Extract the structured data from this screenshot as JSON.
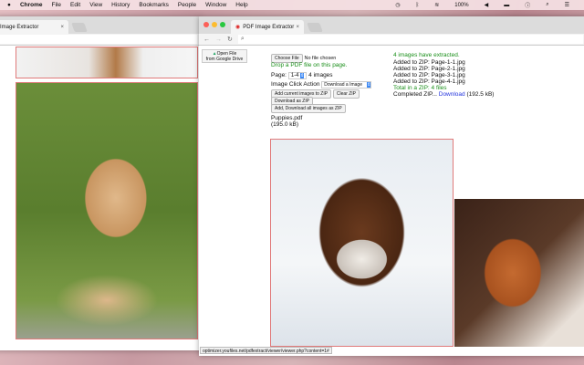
{
  "menubar": {
    "apple": "",
    "app": "Chrome",
    "items": [
      "File",
      "Edit",
      "View",
      "History",
      "Bookmarks",
      "People",
      "Window",
      "Help"
    ],
    "battery": "100%"
  },
  "back_window": {
    "tab_title": "Image Extractor"
  },
  "front_window": {
    "tab_title": "PDF Image Extractor",
    "status_url": "optimizer.youfiles.net/pdfextract/viewer/viewer.php?content=1#"
  },
  "page": {
    "drive_button": [
      "Open File",
      "from Google Drive"
    ],
    "choose_file": "Choose File",
    "no_file": "No file chosen",
    "drop_hint": "Drop a PDF file on this page.",
    "page_label": "Page:",
    "page_value": "1-4",
    "image_count": "4 images",
    "click_action_label": "Image Click Action",
    "click_action_value": "Download a Image",
    "add_zip": "Add current images to ZIP",
    "clear_zip": "Clear ZIP",
    "download_zip": "Download as ZIP",
    "add_download_all": "Add, Download all images as ZIP",
    "file_name": "Puppies.pdf",
    "file_size": "(195.0 kB)"
  },
  "log": {
    "extracted": "4 images have extracted.",
    "added": [
      "Added to ZIP: Page-1-1.jpg",
      "Added to ZIP: Page-2-1.jpg",
      "Added to ZIP: Page-3-1.jpg",
      "Added to ZIP: Page-4-1.jpg"
    ],
    "total": "Total in a ZIP: 4 files",
    "completed": "Completed ZIP... ",
    "download_link": "Download",
    "zip_size": " (192.5 kB)"
  },
  "colors": {
    "green": "#1a8f1a",
    "link": "#2233dd",
    "photo_border": "#e07a7a"
  }
}
